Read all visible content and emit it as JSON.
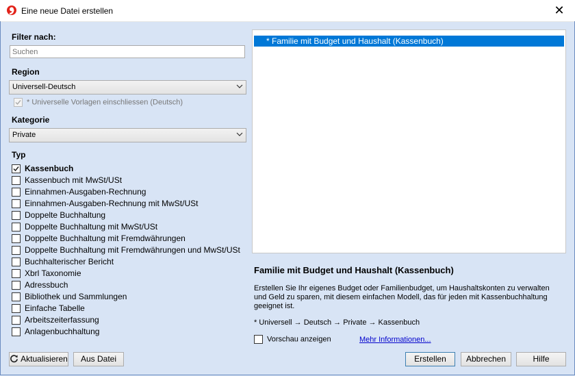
{
  "window": {
    "title": "Eine neue Datei erstellen",
    "close_glyph": "✕"
  },
  "filter": {
    "label": "Filter nach:",
    "search_placeholder": "Suchen"
  },
  "region": {
    "label": "Region",
    "value": "Universell-Deutsch",
    "include_label": "* Universelle Vorlagen einschliessen (Deutsch)",
    "include_checked": true
  },
  "category": {
    "label": "Kategorie",
    "value": "Private"
  },
  "type": {
    "label": "Typ",
    "items": [
      {
        "label": "Kassenbuch",
        "checked": true
      },
      {
        "label": "Kassenbuch mit MwSt/USt",
        "checked": false
      },
      {
        "label": "Einnahmen-Ausgaben-Rechnung",
        "checked": false
      },
      {
        "label": "Einnahmen-Ausgaben-Rechnung mit MwSt/USt",
        "checked": false
      },
      {
        "label": "Doppelte Buchhaltung",
        "checked": false
      },
      {
        "label": "Doppelte Buchhaltung mit MwSt/USt",
        "checked": false
      },
      {
        "label": "Doppelte Buchhaltung mit Fremdwährungen",
        "checked": false
      },
      {
        "label": "Doppelte Buchhaltung mit Fremdwährungen und MwSt/USt",
        "checked": false
      },
      {
        "label": "Buchhalterischer Bericht",
        "checked": false
      },
      {
        "label": "Xbrl Taxonomie",
        "checked": false
      },
      {
        "label": "Adressbuch",
        "checked": false
      },
      {
        "label": "Bibliothek und Sammlungen",
        "checked": false
      },
      {
        "label": "Einfache Tabelle",
        "checked": false
      },
      {
        "label": "Arbeitszeiterfassung",
        "checked": false
      },
      {
        "label": "Anlagenbuchhaltung",
        "checked": false
      }
    ]
  },
  "templates": {
    "selected": "* Familie mit Budget und Haushalt (Kassenbuch)"
  },
  "description": {
    "title": "Familie mit Budget und Haushalt (Kassenbuch)",
    "body": "Erstellen Sie Ihr eigenes Budget oder Familienbudget, um Haushaltskonten zu verwalten und Geld zu sparen, mit diesem einfachen Modell, das für jeden mit Kassenbuchhaltung geeignet ist.",
    "path": "* Universell → Deutsch → Private → Kassenbuch"
  },
  "preview": {
    "label": "Vorschau anzeigen",
    "checked": false
  },
  "more_info": "Mehr Informationen...",
  "buttons": {
    "refresh": "Aktualisieren",
    "from_file": "Aus Datei",
    "create": "Erstellen",
    "cancel": "Abbrechen",
    "help": "Hilfe"
  },
  "colors": {
    "selection": "#0078d7",
    "background": "#d8e4f5",
    "link": "#0000cc"
  }
}
